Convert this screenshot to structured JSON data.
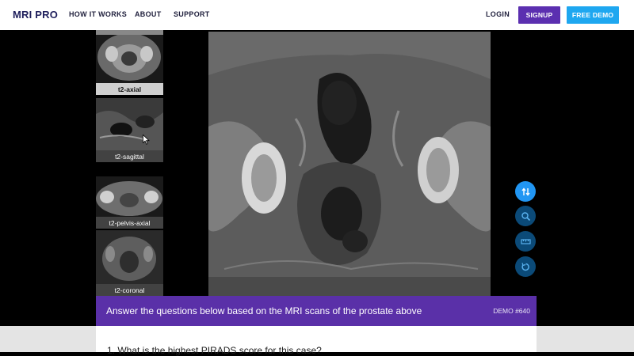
{
  "header": {
    "logo": "MRI PRO",
    "nav": [
      "HOW IT WORKS",
      "ABOUT",
      "SUPPORT"
    ],
    "login": "LOGIN",
    "signup": "SIGNUP",
    "free_demo": "FREE DEMO"
  },
  "colors": {
    "brand": "#1f1f5c",
    "signup_bg": "#5b2fb0",
    "demo_bg": "#1ea7f0",
    "bar_bg": "#5a30a8",
    "tool_active": "#2196f3",
    "tool_inactive": "#0b4a78"
  },
  "thumbnails": [
    {
      "label": "t2-axial",
      "active": true
    },
    {
      "label": "t2-sagittal",
      "active": false
    },
    {
      "label": "t2-pelvis-axial",
      "active": false
    },
    {
      "label": "t2-coronal",
      "active": false
    }
  ],
  "tools": [
    {
      "icon": "swap-vert-icon",
      "active": true
    },
    {
      "icon": "zoom-icon",
      "active": false
    },
    {
      "icon": "ruler-icon",
      "active": false
    },
    {
      "icon": "reset-icon",
      "active": false
    }
  ],
  "bar": {
    "message": "Answer the questions below based on the MRI scans of the prostate above",
    "demo_id": "DEMO #640"
  },
  "question": "1.  What is the highest PIRADS score for this case?"
}
